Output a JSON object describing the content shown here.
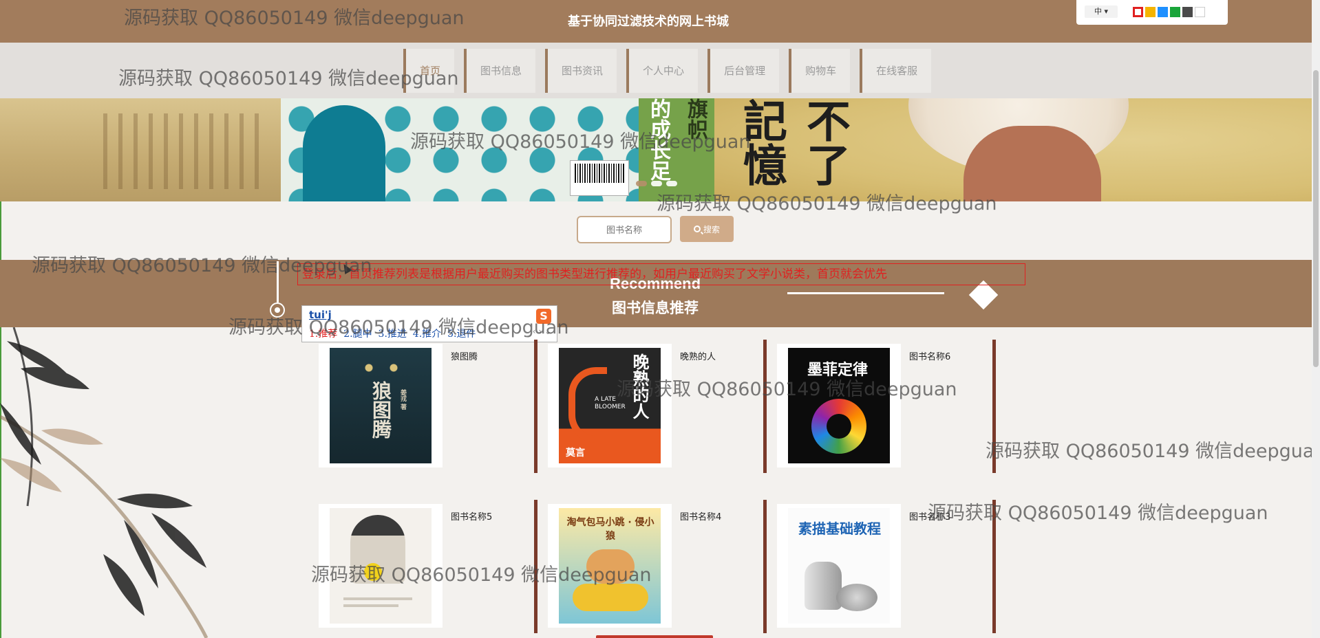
{
  "header": {
    "site_title": "基于协同过滤技术的网上书城",
    "lang_selector": "中 ▾",
    "theme_colors": [
      "#e02020",
      "#f5b400",
      "#1e90ff",
      "#19a53a",
      "#4a4a4a",
      "#ffffff"
    ]
  },
  "nav": {
    "items": [
      {
        "label": "首页",
        "active": true
      },
      {
        "label": "图书信息",
        "active": false
      },
      {
        "label": "图书资讯",
        "active": false
      },
      {
        "label": "个人中心",
        "active": false
      },
      {
        "label": "后台管理",
        "active": false
      },
      {
        "label": "购物车",
        "active": false
      },
      {
        "label": "在线客服",
        "active": false
      }
    ]
  },
  "banner": {
    "calligraphy_1": "旗帜",
    "calligraphy_2": "不了記憶",
    "green_strip_text": "的成长足",
    "slide_count": 3,
    "active_slide": 1
  },
  "search": {
    "placeholder": "图书名称",
    "button_label": "搜索"
  },
  "recommend": {
    "title_en": "Recommend",
    "title_cn": "图书信息推荐",
    "notice": "登录后，首页推荐列表是根据用户最近购买的图书类型进行推荐的，如用户最近购买了文学小说类，首页就会优先"
  },
  "ime": {
    "composition": "tui'j",
    "candidates": [
      "1.推荐",
      "2.腿中",
      "3.推进",
      "4.推介",
      "5.退件"
    ],
    "arrows": "‹ ›  ⌄"
  },
  "books": [
    {
      "title": "狼图腾",
      "cover_text": "狼图腾"
    },
    {
      "title": "晚熟的人",
      "cover_text": "晚熟的人"
    },
    {
      "title": "图书名称6",
      "cover_text": "墨菲定律"
    },
    {
      "title": "图书名称5",
      "cover_text": ""
    },
    {
      "title": "图书名称4",
      "cover_text": "淘气包马小跳 · 侵小狼"
    },
    {
      "title": "图书名称3",
      "cover_text": "素描基础教程"
    }
  ],
  "book_cover_extras": {
    "late_bloomer_en": "A LATE BLOOMER",
    "late_bloomer_author": "莫言",
    "wolf_author": "姜戎 著"
  },
  "watermark": "源码获取 QQ86050149 微信deepguan"
}
